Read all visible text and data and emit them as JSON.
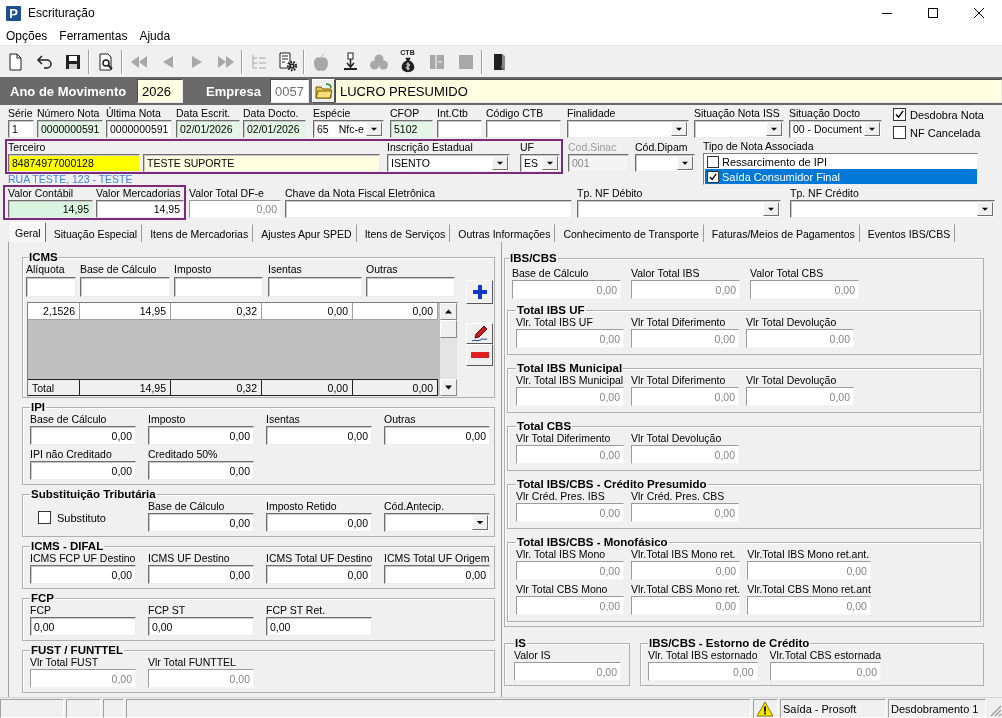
{
  "window": {
    "logo": "P",
    "title": "Escrituração"
  },
  "menu": [
    "Opções",
    "Ferramentas",
    "Ajuda"
  ],
  "toolbar": [
    [
      {
        "kind": "new",
        "disabled": false
      },
      {
        "kind": "undo",
        "disabled": false
      },
      {
        "kind": "save",
        "disabled": false
      }
    ],
    [
      {
        "kind": "preview",
        "disabled": false
      }
    ],
    [
      {
        "kind": "first",
        "disabled": true
      },
      {
        "kind": "previous",
        "disabled": true
      },
      {
        "kind": "next",
        "disabled": true
      },
      {
        "kind": "last",
        "disabled": true
      }
    ],
    [
      {
        "kind": "tree",
        "disabled": true
      },
      {
        "kind": "report",
        "disabled": false
      }
    ],
    [
      {
        "kind": "apple",
        "disabled": true
      },
      {
        "kind": "import",
        "disabled": false
      },
      {
        "kind": "cluster",
        "disabled": true
      },
      {
        "kind": "bag",
        "label": "CTB",
        "disabled": false
      },
      {
        "kind": "columns",
        "disabled": true
      },
      {
        "kind": "block",
        "disabled": true
      }
    ],
    [
      {
        "kind": "exit",
        "disabled": false
      }
    ]
  ],
  "year_bar": {
    "year_label": "Ano de Movimento",
    "year": "2026",
    "company_label": "Empresa",
    "company_code": "0057",
    "company_name": "LUCRO PRESUMIDO"
  },
  "header": {
    "row1": [
      {
        "label": "Série",
        "value": "1",
        "kind": "text",
        "color": "#ffffff"
      },
      {
        "label": "Número Nota",
        "value": "0000000591",
        "kind": "text",
        "color": "#e4f6e6"
      },
      {
        "label": "Última Nota",
        "value": "0000000591",
        "kind": "text",
        "color": "#ffffff"
      },
      {
        "label": "Data Escrit.",
        "value": "02/01/2026",
        "kind": "text",
        "color": "#e4f6e6"
      },
      {
        "label": "Data Docto.",
        "value": "02/01/2026",
        "kind": "text",
        "color": "#e4f6e6"
      },
      {
        "label": "Espécie",
        "value": "65",
        "description": "Nfc-e",
        "kind": "combo",
        "color": "#ffffff"
      },
      {
        "label": "CFOP",
        "value": "5102",
        "kind": "text",
        "color": "#e4f6e6"
      },
      {
        "label": "Int.Ctb",
        "kind": "text",
        "color": "#ffffff"
      },
      {
        "label": "Código CTB",
        "kind": "text",
        "color": "#ffffff"
      },
      {
        "label": "Finalidade",
        "kind": "combo",
        "color": "#ffffff"
      },
      {
        "label": "Situação Nota ISS",
        "kind": "combo",
        "color": "#ffffff"
      },
      {
        "label": "Situação Docto",
        "value": "00 - Document",
        "kind": "combo",
        "color": "#ffffff"
      }
    ],
    "flags": [
      {
        "label": "Desdobra Nota",
        "checked": true
      },
      {
        "label": "NF Cancelada",
        "checked": false
      }
    ],
    "party": {
      "highlighted": true,
      "fields": [
        {
          "label": "Terceiro",
          "value": "84874977000128",
          "kind": "text",
          "color": "#ffff00"
        },
        {
          "value": "TESTE SUPORTE",
          "kind": "text",
          "color": "#ffffe1"
        },
        {
          "label": "Inscrição Estadual",
          "value": "ISENTO",
          "kind": "combo",
          "color": "#ffffff"
        },
        {
          "label": "UF",
          "value": "ES",
          "kind": "combo",
          "color": "#ffffff"
        }
      ]
    },
    "address": "RUA TESTE, 123 - TESTE",
    "codes": [
      {
        "label": "Cod.Sinac",
        "value": "001",
        "kind": "text",
        "disabled": true
      },
      {
        "label": "Cód.Dipam",
        "kind": "combo",
        "disabled": false
      }
    ],
    "note_types": {
      "label": "Tipo de Nota Associada",
      "items": [
        {
          "label": "Ressarcimento de IPI",
          "checked": false,
          "selected": false
        },
        {
          "label": "Saída Consumidor Final",
          "checked": true,
          "selected": true
        }
      ]
    },
    "values": {
      "highlighted": true,
      "fields": [
        {
          "label": "Valor Contábil",
          "value": "14,95",
          "kind": "number",
          "color": "#d9f5e0"
        },
        {
          "label": "Valor Mercadorias",
          "value": "14,95",
          "kind": "number",
          "color": "#ffffff"
        }
      ]
    },
    "row3": [
      {
        "label": "Valor Total DF-e",
        "value": "0,00",
        "kind": "number",
        "read_only": true
      },
      {
        "label": "Chave da Nota Fiscal Eletrônica",
        "kind": "text",
        "read_only": false
      },
      {
        "label": "Tp. NF Débito",
        "kind": "combo",
        "read_only": false
      },
      {
        "label": "Tp. NF Crédito",
        "kind": "combo",
        "read_only": false
      }
    ]
  },
  "tabs": [
    {
      "label": "Geral",
      "selected": true
    },
    {
      "label": "Situação Especial",
      "selected": false
    },
    {
      "label": "Itens de Mercadorias",
      "selected": false
    },
    {
      "label": "Ajustes Apur SPED",
      "selected": false
    },
    {
      "label": "Itens de Serviços",
      "selected": false
    },
    {
      "label": "Outras Informações",
      "selected": false
    },
    {
      "label": "Conhecimento de Transporte",
      "selected": false
    },
    {
      "label": "Faturas/Meios de Pagamentos",
      "selected": false
    },
    {
      "label": "Eventos IBS/CBS",
      "selected": false
    }
  ],
  "icms": {
    "title": "ICMS",
    "columns": [
      "Alíquota",
      "Base de Cálculo",
      "Imposto",
      "Isentas",
      "Outras"
    ],
    "rows": [
      [
        "2,1526",
        "14,95",
        "0,32",
        "0,00",
        "0,00"
      ]
    ],
    "total": {
      "label": "Total",
      "values": [
        "14,95",
        "0,32",
        "0,00",
        "0,00"
      ]
    }
  },
  "left_groups": [
    {
      "title": "IPI",
      "rows": [
        [
          {
            "label": "Base de Cálculo",
            "value": "0,00",
            "kind": "number",
            "read_only": false
          },
          {
            "label": "Imposto",
            "value": "0,00",
            "kind": "number",
            "read_only": false
          },
          {
            "label": "Isentas",
            "value": "0,00",
            "kind": "number",
            "read_only": false
          },
          {
            "label": "Outras",
            "value": "0,00",
            "kind": "number",
            "read_only": false
          }
        ],
        [
          {
            "label": "IPI não Creditado",
            "value": "0,00",
            "kind": "number",
            "read_only": false
          },
          {
            "label": "Creditado 50%",
            "value": "0,00",
            "kind": "number",
            "read_only": false
          }
        ]
      ]
    },
    {
      "title": "Substituição Tributária",
      "rows": [
        [
          {
            "label": "Substituto",
            "kind": "check",
            "checked": false
          },
          {
            "label": "Base de Cálculo",
            "value": "0,00",
            "kind": "number",
            "read_only": false
          },
          {
            "label": "Imposto Retido",
            "value": "0,00",
            "kind": "number",
            "read_only": false
          },
          {
            "label": "Cód.Antecip.",
            "kind": "combo",
            "read_only": false
          }
        ]
      ]
    },
    {
      "title": "ICMS - DIFAL",
      "rows": [
        [
          {
            "label": "ICMS FCP UF Destino",
            "value": "0,00",
            "kind": "number",
            "read_only": false
          },
          {
            "label": "ICMS UF Destino",
            "value": "0,00",
            "kind": "number",
            "read_only": false
          },
          {
            "label": "ICMS Total UF Destino",
            "value": "0,00",
            "kind": "number",
            "read_only": false
          },
          {
            "label": "ICMS Total UF Origem",
            "value": "0,00",
            "kind": "number",
            "read_only": false
          }
        ]
      ]
    },
    {
      "title": "FCP",
      "rows": [
        [
          {
            "label": "FCP",
            "value": "0,00",
            "kind": "text",
            "read_only": false
          },
          {
            "label": "FCP ST",
            "value": "0,00",
            "kind": "text",
            "read_only": false
          },
          {
            "label": "FCP ST Ret.",
            "value": "0,00",
            "kind": "text",
            "read_only": false
          }
        ]
      ]
    },
    {
      "title": "FUST / FUNTTEL",
      "rows": [
        [
          {
            "label": "Vlr Total FUST",
            "value": "0,00",
            "kind": "number",
            "read_only": true
          },
          {
            "label": "Vlr Total FUNTTEL",
            "value": "0,00",
            "kind": "number",
            "read_only": true
          }
        ]
      ]
    }
  ],
  "ibs_cbs": {
    "title": "IBS/CBS",
    "rows": [
      [
        {
          "label": "Base de Cálculo",
          "value": "0,00",
          "kind": "number",
          "read_only": true
        },
        {
          "label": "Valor Total IBS",
          "value": "0,00",
          "kind": "number",
          "read_only": true
        },
        {
          "label": "Valor Total CBS",
          "value": "0,00",
          "kind": "number",
          "read_only": true
        }
      ]
    ],
    "subgroups": [
      {
        "title": "Total IBS UF",
        "rows": [
          [
            {
              "label": "Vlr. Total IBS UF",
              "value": "0,00",
              "kind": "number",
              "read_only": true
            },
            {
              "label": "Vlr Total Diferimento",
              "value": "0,00",
              "kind": "number",
              "read_only": true
            },
            {
              "label": "Vlr Total Devolução",
              "value": "0,00",
              "kind": "number",
              "read_only": true
            }
          ]
        ]
      },
      {
        "title": "Total IBS Municipal",
        "rows": [
          [
            {
              "label": "Vlr. Total IBS Municipal",
              "value": "0,00",
              "kind": "number",
              "read_only": true
            },
            {
              "label": "Vlr Total Diferimento",
              "value": "0,00",
              "kind": "number",
              "read_only": true
            },
            {
              "label": "Vlr Total Devolução",
              "value": "0,00",
              "kind": "number",
              "read_only": true
            }
          ]
        ]
      },
      {
        "title": "Total CBS",
        "rows": [
          [
            {
              "label": "Vlr Total Diferimento",
              "value": "0,00",
              "kind": "number",
              "read_only": true
            },
            {
              "label": "Vlr Total Devolução",
              "value": "0,00",
              "kind": "number",
              "read_only": true
            }
          ]
        ]
      },
      {
        "title": "Total IBS/CBS - Crédito Presumido",
        "rows": [
          [
            {
              "label": "Vlr Créd. Pres. IBS",
              "value": "0,00",
              "kind": "number",
              "read_only": true
            },
            {
              "label": "Vlr Créd. Pres. CBS",
              "value": "0,00",
              "kind": "number",
              "read_only": true
            }
          ]
        ]
      },
      {
        "title": "Total IBS/CBS - Monofásico",
        "rows": [
          [
            {
              "label": "Vlr. Total IBS Mono",
              "value": "0,00",
              "kind": "number",
              "read_only": true
            },
            {
              "label": "Vlr.Total IBS Mono ret.",
              "value": "0,00",
              "kind": "number",
              "read_only": true
            },
            {
              "label": "Vlr.Total IBS Mono ret.ant.",
              "value": "0,00",
              "kind": "number",
              "read_only": true
            }
          ],
          [
            {
              "label": "Vlr Total CBS Mono",
              "value": "0,00",
              "kind": "number",
              "read_only": true
            },
            {
              "label": "Vlr.Total CBS Mono ret.",
              "value": "0,00",
              "kind": "number",
              "read_only": true
            },
            {
              "label": "Vlr.Total CBS Mono ret.ant",
              "value": "0,00",
              "kind": "number",
              "read_only": true
            }
          ]
        ]
      }
    ]
  },
  "bottom_groups": [
    {
      "title": "IS",
      "rows": [
        [
          {
            "label": "Valor IS",
            "value": "0,00",
            "kind": "number",
            "read_only": true
          }
        ]
      ]
    },
    {
      "title": "IBS/CBS - Estorno de Crédito",
      "rows": [
        [
          {
            "label": "Vlr. Total IBS estornado",
            "value": "0,00",
            "kind": "number",
            "read_only": true
          },
          {
            "label": "Vlr.Total CBS estornada",
            "value": "0,00",
            "kind": "number",
            "read_only": true
          }
        ]
      ]
    }
  ],
  "status_bar": [
    "Saída - Prosoft",
    "Desdobramento 1"
  ]
}
